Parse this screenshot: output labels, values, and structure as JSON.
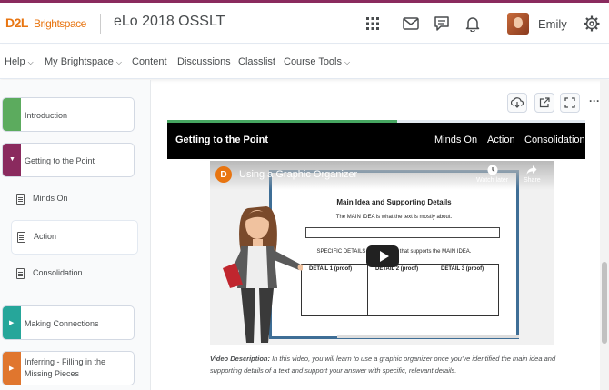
{
  "brand": {
    "d2l": "D2L",
    "name": "Brightspace"
  },
  "course_title": "eLo 2018 OSSLT",
  "user": {
    "name": "Emily"
  },
  "nav": [
    {
      "label": "Help",
      "dropdown": true
    },
    {
      "label": "My Brightspace",
      "dropdown": true
    },
    {
      "label": "Content",
      "dropdown": false
    },
    {
      "label": "Discussions",
      "dropdown": false
    },
    {
      "label": "Classlist",
      "dropdown": false
    },
    {
      "label": "Course Tools",
      "dropdown": true
    }
  ],
  "sidebar": {
    "modules": [
      {
        "label": "Introduction",
        "color": "#5cab5e",
        "expanded": false
      },
      {
        "label": "Getting to the Point",
        "color": "#8a2a5e",
        "expanded": true
      },
      {
        "label": "Making Connections",
        "color": "#26a69a",
        "expanded": false
      },
      {
        "label": "Inferring - Filling in the Missing Pieces",
        "color": "#e0762e",
        "expanded": false
      }
    ],
    "topics": [
      {
        "label": "Minds On"
      },
      {
        "label": "Action"
      },
      {
        "label": "Consolidation"
      }
    ]
  },
  "toolbar": {
    "more_label": "···"
  },
  "lesson": {
    "progress": 0.55,
    "title": "Getting to the Point",
    "links": [
      "Minds On",
      "Action",
      "Consolidation"
    ]
  },
  "video": {
    "channel_letter": "D",
    "title": "Using a Graphic Organizer",
    "watch_later": "Watch later",
    "share": "Share",
    "board_title": "Main Idea and Supporting Details",
    "main_idea_line": "The MAIN IDEA is what the text is mostly about.",
    "details_line": "SPECIFIC DETAILS are the proof that supports the MAIN IDEA.",
    "table_headers": [
      "DETAIL 1 (proof)",
      "DETAIL 2 (proof)",
      "DETAIL 3 (proof)"
    ]
  },
  "description": {
    "label": "Video Description:",
    "text": "In this video, you will learn to use a graphic organizer once you've identified the main idea and supporting details of a text and support your answer with specific, relevant details."
  }
}
